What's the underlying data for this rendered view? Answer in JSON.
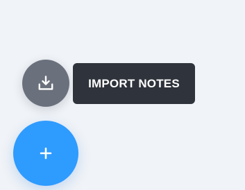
{
  "colors": {
    "background": "#f0f3f7",
    "mini_fab": "#6b717c",
    "tooltip_bg": "#2f333b",
    "primary_fab": "#2e9bff",
    "icon": "#ffffff"
  },
  "actions": {
    "import_notes": {
      "label": "IMPORT NOTES",
      "icon": "download-tray-icon"
    },
    "add": {
      "icon": "plus-icon"
    }
  }
}
